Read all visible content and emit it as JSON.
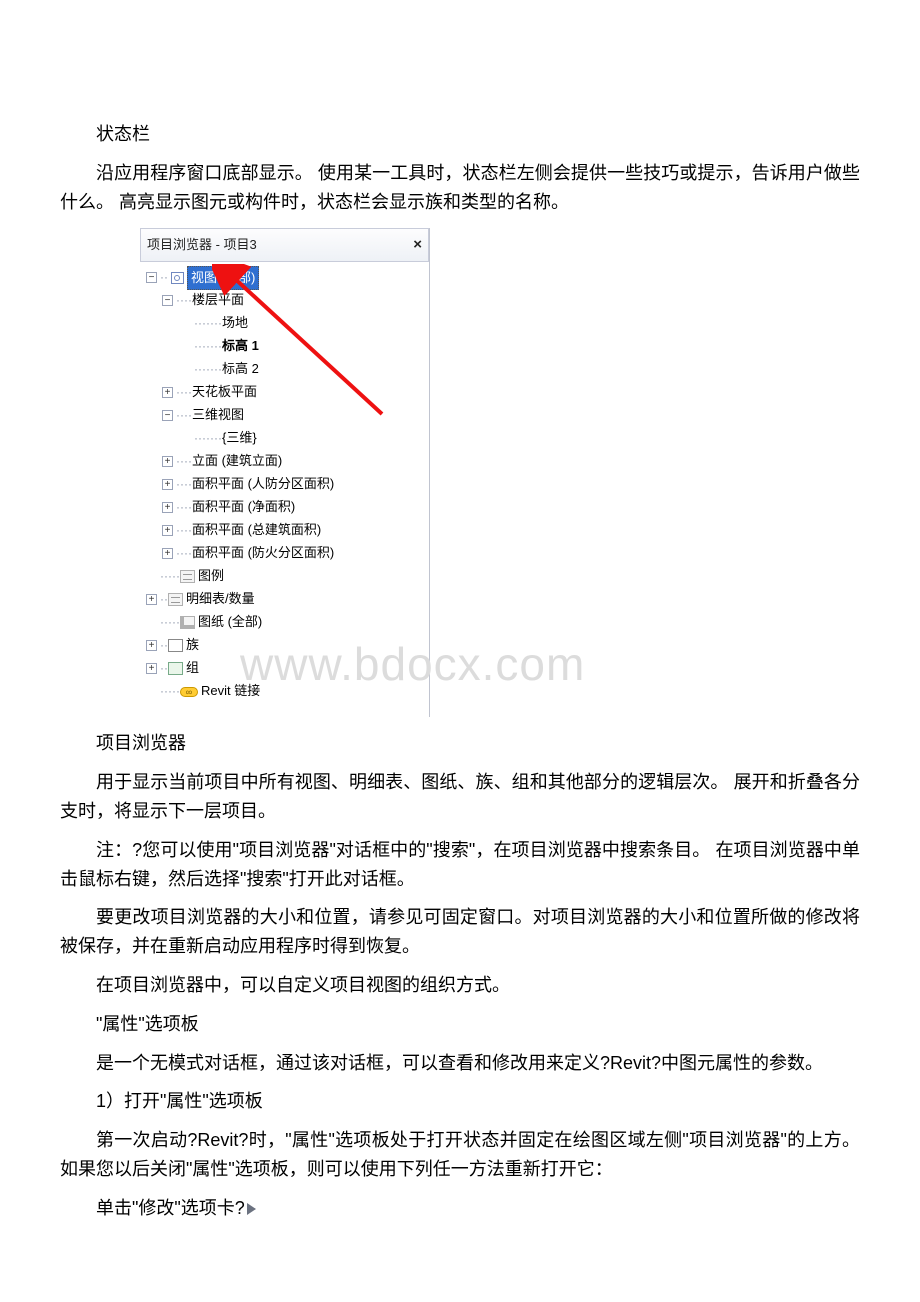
{
  "paragraphs": {
    "p1": "状态栏",
    "p2": "沿应用程序窗口底部显示。 使用某一工具时，状态栏左侧会提供一些技巧或提示，告诉用户做些什么。 高亮显示图元或构件时，状态栏会显示族和类型的名称。",
    "p3": "项目浏览器",
    "p4": "用于显示当前项目中所有视图、明细表、图纸、族、组和其他部分的逻辑层次。 展开和折叠各分支时，将显示下一层项目。",
    "p5": "注：?您可以使用\"项目浏览器\"对话框中的\"搜索\"，在项目浏览器中搜索条目。 在项目浏览器中单击鼠标右键，然后选择\"搜索\"打开此对话框。",
    "p6": "要更改项目浏览器的大小和位置，请参见可固定窗口。对项目浏览器的大小和位置所做的修改将被保存，并在重新启动应用程序时得到恢复。",
    "p7": "在项目浏览器中，可以自定义项目视图的组织方式。",
    "p8": "\"属性\"选项板",
    "p9": "是一个无模式对话框，通过该对话框，可以查看和修改用来定义?Revit?中图元属性的参数。",
    "p10": "1）打开\"属性\"选项板",
    "p11": "第一次启动?Revit?时，\"属性\"选项板处于打开状态并固定在绘图区域左侧\"项目浏览器\"的上方。 如果您以后关闭\"属性\"选项板，则可以使用下列任一方法重新打开它：",
    "p12": "单击\"修改\"选项卡?"
  },
  "panel": {
    "title": "项目浏览器 - 项目3",
    "close": "×",
    "r_root_hl_a": "视图",
    "r_root_hl_b": "(全部)",
    "r_floor": "楼层平面",
    "r_site": "场地",
    "r_lvl1": "标高 1",
    "r_lvl2": "标高 2",
    "r_ceil": "天花板平面",
    "r_3d": "三维视图",
    "r_3dv": "{三维}",
    "r_elev": "立面 (建筑立面)",
    "r_area1": "面积平面 (人防分区面积)",
    "r_area2": "面积平面 (净面积)",
    "r_area3": "面积平面 (总建筑面积)",
    "r_area4": "面积平面 (防火分区面积)",
    "r_legend": "图例",
    "r_sched": "明细表/数量",
    "r_sheets": "图纸 (全部)",
    "r_fam": "族",
    "r_grp": "组",
    "r_link": "Revit 链接"
  },
  "watermark": "www.bdocx.com"
}
